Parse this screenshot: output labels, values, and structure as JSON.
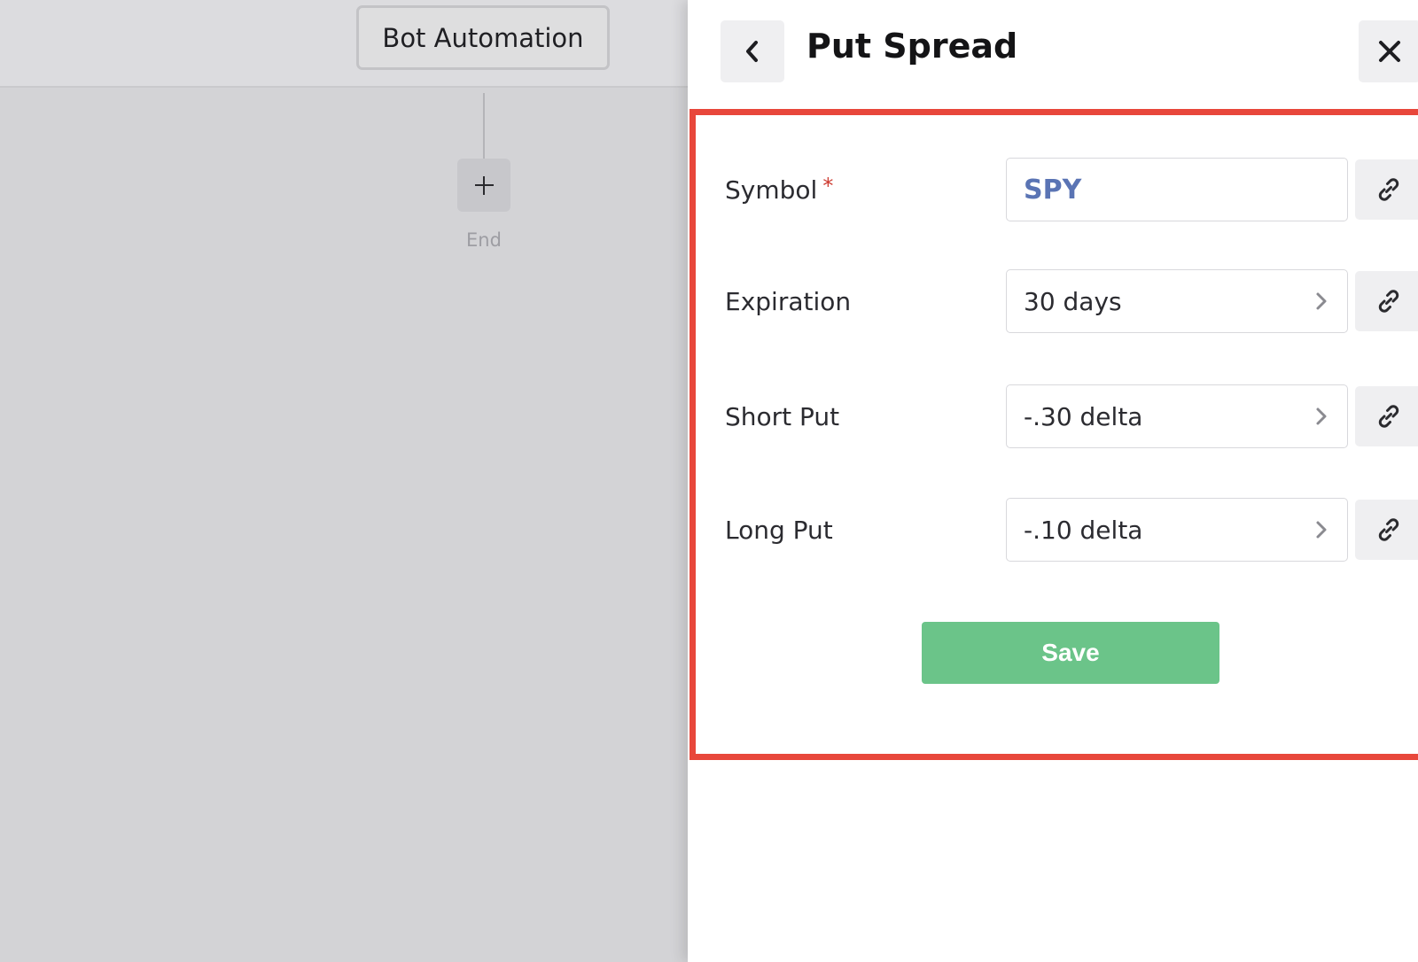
{
  "canvas": {
    "root_node_label": "Bot Automation",
    "end_label": "End"
  },
  "panel": {
    "title": "Put Spread",
    "icons": {
      "back": "chevron-left-icon",
      "close": "close-icon",
      "link": "link-icon",
      "chevron": "chevron-right-icon"
    },
    "fields": [
      {
        "label": "Symbol",
        "required_mark": "*",
        "value": "SPY"
      },
      {
        "label": "Expiration",
        "value": "30 days"
      },
      {
        "label": "Short Put",
        "value": "-.30 delta"
      },
      {
        "label": "Long Put",
        "value": "-.10 delta"
      }
    ],
    "save_label": "Save",
    "colors": {
      "highlight_border": "#e8473b",
      "save_button": "#6bc489",
      "symbol_text": "#5a74b4",
      "required_mark": "#cd3b31"
    }
  }
}
